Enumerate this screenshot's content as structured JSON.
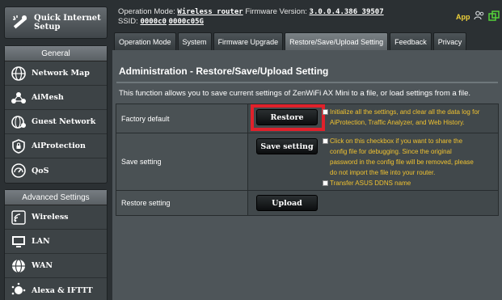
{
  "sidebar": {
    "quick_setup": {
      "label_line1": "Quick Internet",
      "label_line2": "Setup",
      "icon": "wizard-icon"
    },
    "general": {
      "header": "General",
      "items": [
        {
          "label": "Network Map",
          "icon": "globe-network-icon"
        },
        {
          "label": "AiMesh",
          "icon": "mesh-nodes-icon"
        },
        {
          "label": "Guest Network",
          "icon": "guest-globe-icon"
        },
        {
          "label": "AiProtection",
          "icon": "shield-lock-icon"
        },
        {
          "label": "QoS",
          "icon": "gauge-icon"
        }
      ]
    },
    "advanced": {
      "header": "Advanced Settings",
      "items": [
        {
          "label": "Wireless",
          "icon": "wifi-icon"
        },
        {
          "label": "LAN",
          "icon": "monitor-icon"
        },
        {
          "label": "WAN",
          "icon": "globe-icon"
        },
        {
          "label": "Alexa & IFTTT",
          "icon": "voice-assistant-icon"
        }
      ]
    }
  },
  "header": {
    "op_mode_label": "Operation Mode:",
    "op_mode_value": "Wireless router",
    "firmware_label": "Firmware Version:",
    "firmware_value": "3.0.0.4.386_39507",
    "ssid_label": "SSID:",
    "ssid_1": "0000c0",
    "ssid_2": "0000c05G",
    "app_label": "App",
    "icons": [
      "users-icon",
      "copy-screens-icon"
    ],
    "accent": "#f0d23a"
  },
  "tabs": [
    {
      "label": "Operation Mode",
      "active": false
    },
    {
      "label": "System",
      "active": false
    },
    {
      "label": "Firmware Upgrade",
      "active": false
    },
    {
      "label": "Restore/Save/Upload Setting",
      "active": true
    },
    {
      "label": "Feedback",
      "active": false
    },
    {
      "label": "Privacy",
      "active": false
    }
  ],
  "main": {
    "title": "Administration - Restore/Save/Upload Setting",
    "description": "This function allows you to save current settings of ZenWiFi AX Mini to a file, or load settings from a file.",
    "rows": {
      "factory": {
        "label": "Factory default",
        "button": "Restore",
        "note_line1": "Initialize all the settings, and clear all the data log for",
        "note_line2": "AiProtection, Traffic Analyzer, and Web History."
      },
      "save": {
        "label": "Save setting",
        "button": "Save setting",
        "note_line1": "Click on this checkbox if you want to share the",
        "note_line2": "config file for debugging. Since the original",
        "note_line3": "password in the config file will be removed, please",
        "note_line4": "do not import the file into your router.",
        "note_line5": "Transfer ASUS DDNS name"
      },
      "restore": {
        "label": "Restore setting",
        "button": "Upload"
      }
    },
    "highlight_color": "#e0212b",
    "note_color": "#f0c230"
  }
}
